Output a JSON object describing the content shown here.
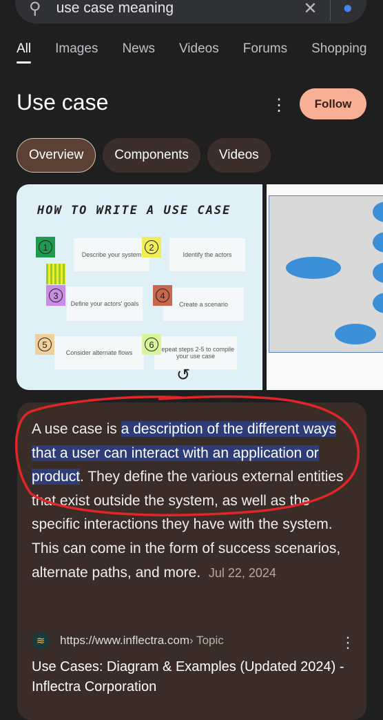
{
  "search": {
    "query": "use case meaning",
    "search_icon": "search-icon",
    "clear_icon": "close-icon",
    "mic_icon": "mic-icon"
  },
  "tabs": [
    {
      "label": "All",
      "active": true
    },
    {
      "label": "Images"
    },
    {
      "label": "News"
    },
    {
      "label": "Videos"
    },
    {
      "label": "Forums"
    },
    {
      "label": "Shopping"
    }
  ],
  "header": {
    "title": "Use case",
    "more_icon": "more-vert-icon",
    "follow_label": "Follow"
  },
  "chips": [
    {
      "label": "Overview",
      "selected": true
    },
    {
      "label": "Components"
    },
    {
      "label": "Videos"
    }
  ],
  "images": {
    "infographic": {
      "title": "HOW TO WRITE A USE CASE",
      "steps": [
        {
          "n": "1",
          "text": "Describe your system"
        },
        {
          "n": "2",
          "text": "Identify the actors"
        },
        {
          "n": "3",
          "text": "Define your actors' goals"
        },
        {
          "n": "4",
          "text": "Create a scenario"
        },
        {
          "n": "5",
          "text": "Consider alternate flows"
        },
        {
          "n": "6",
          "text": "Repeat steps 2-5 to compile your use case"
        }
      ]
    },
    "diagram": "use-case-diagram-image"
  },
  "overview": {
    "text_before": "A use case is ",
    "highlight": "a description of the different ways that a user can interact with an application or product",
    "text_after": ". They define the various external entities that exist outside the system, as well as the specific interactions they have with the system. This can come in the form of success scenarios, alternate paths, and more.",
    "date": "Jul 22, 2024",
    "source_url": "https://www.inflectra.com",
    "source_path": " › Topic",
    "link_title": "Use Cases: Diagram & Examples (Updated 2024) - Inflectra Corporation"
  },
  "colors": {
    "background": "#1f1f1f",
    "card": "#3a2c27",
    "highlight": "#2e3d78",
    "follow": "#f7b096",
    "annotation": "#e0262a"
  }
}
